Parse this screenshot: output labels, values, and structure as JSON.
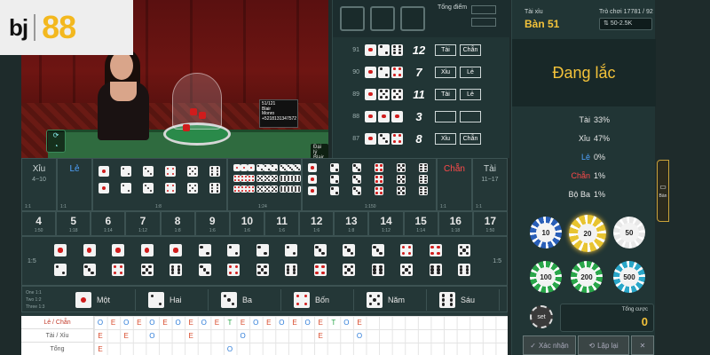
{
  "logo": {
    "brand_a": "bj",
    "brand_b": "88"
  },
  "video": {
    "screen_lines": [
      "51/121",
      "Blair",
      "Monro",
      "+5218131347572"
    ],
    "dealer_tag": "Đại lý Blair",
    "refresh_icon": "refresh-icon",
    "signal_icon": "wifi-icon"
  },
  "history": {
    "total_label": "Tổng điểm",
    "rows": [
      {
        "idx": "91",
        "dice": [
          1,
          2,
          6
        ],
        "sum": "12",
        "a": "Tài",
        "b": "Chẵn"
      },
      {
        "idx": "90",
        "dice": [
          1,
          2,
          4
        ],
        "sum": "7",
        "a": "Xỉu",
        "b": "Lẻ"
      },
      {
        "idx": "89",
        "dice": [
          1,
          5,
          5
        ],
        "sum": "11",
        "a": "Tài",
        "b": "Lẻ"
      },
      {
        "idx": "88",
        "dice": [
          1,
          1,
          1
        ],
        "sum": "3",
        "a": "",
        "b": ""
      },
      {
        "idx": "87",
        "dice": [
          1,
          3,
          4
        ],
        "sum": "8",
        "a": "Xỉu",
        "b": "Chẵn"
      }
    ]
  },
  "right": {
    "game_label": "Tài xỉu",
    "table_name": "Bàn 51",
    "round_label": "Trò chơi 17781 / 92",
    "limit": "50-2.5K",
    "status": "Đang lắc",
    "stats": [
      {
        "label": "Tài",
        "pct": "33%",
        "color": "#e6e6e6"
      },
      {
        "label": "Xỉu",
        "pct": "47%",
        "color": "#e6e6e6"
      },
      {
        "label": "Lẻ",
        "pct": "0%",
        "color": "#4fa3ff"
      },
      {
        "label": "Chẵn",
        "pct": "1%",
        "color": "#ff4a4a"
      },
      {
        "label": "Bộ Ba",
        "pct": "1%",
        "color": "#e6e6e6"
      }
    ],
    "chips": [
      "10",
      "20",
      "50",
      "100",
      "200",
      "500"
    ],
    "set_label": "set",
    "total_bet_label": "Tổng cược",
    "total_bet_value": "0",
    "confirm_label": "Xác nhận",
    "rebet_label": "Lặp lại",
    "side_tab_label": "Bàn"
  },
  "board": {
    "xiu_label": "Xỉu",
    "xiu_range": "4~10",
    "xiu_odds": "1:1",
    "le_label": "Lẻ",
    "le_odds": "1:1",
    "chan_label": "Chẵn",
    "chan_odds": "1:1",
    "tai_label": "Tài",
    "tai_range": "11~17",
    "tai_odds": "1:1",
    "double_odds": "1:8",
    "triple_any_odds": "1:24",
    "triple_odds": "1:150",
    "totals": [
      {
        "n": "4",
        "o": "1:50"
      },
      {
        "n": "5",
        "o": "1:18"
      },
      {
        "n": "6",
        "o": "1:14"
      },
      {
        "n": "7",
        "o": "1:12"
      },
      {
        "n": "8",
        "o": "1:8"
      },
      {
        "n": "9",
        "o": "1:6"
      },
      {
        "n": "10",
        "o": "1:6"
      },
      {
        "n": "11",
        "o": "1:6"
      },
      {
        "n": "12",
        "o": "1:6"
      },
      {
        "n": "13",
        "o": "1:8"
      },
      {
        "n": "14",
        "o": "1:12"
      },
      {
        "n": "15",
        "o": "1:14"
      },
      {
        "n": "16",
        "o": "1:18"
      },
      {
        "n": "17",
        "o": "1:50"
      }
    ],
    "combo_odds_l": "1:5",
    "combo_odds_r": "1:5",
    "single_odds": [
      "One 1:1",
      "Two 1:2",
      "Three 1:3"
    ],
    "faces": [
      "Một",
      "Hai",
      "Ba",
      "Bốn",
      "Năm",
      "Sáu"
    ]
  },
  "roadmap": {
    "labels": [
      "Lẻ / Chẵn",
      "Tài / Xỉu",
      "Tổng"
    ],
    "row1": [
      "O",
      "E",
      "O",
      "E",
      "O",
      "E",
      "O",
      "E",
      "O",
      "E",
      "T",
      "E",
      "O",
      "E",
      "O",
      "E",
      "O",
      "E",
      "T",
      "O",
      "E"
    ],
    "row2": [
      "E",
      "",
      "E",
      "",
      "O",
      "",
      "",
      "E",
      "",
      "",
      "",
      "O",
      "",
      "",
      "",
      "",
      "",
      "E",
      "",
      "",
      "O"
    ],
    "row3": [
      "E",
      "",
      "",
      "",
      "",
      "",
      "",
      "",
      "",
      "",
      "O",
      "",
      "",
      "",
      "",
      "",
      "",
      "",
      "",
      "",
      ""
    ]
  }
}
